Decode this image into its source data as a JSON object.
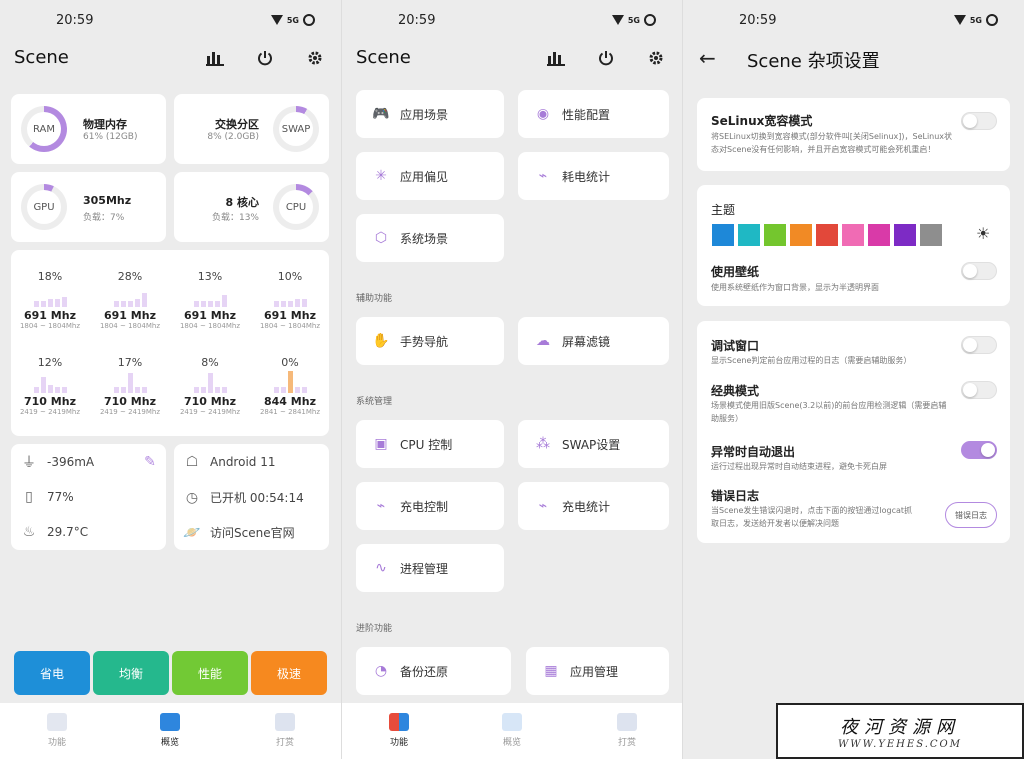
{
  "status": {
    "time": "20:59",
    "net": "5G"
  },
  "panel1": {
    "title": "Scene",
    "ram": {
      "label": "RAM",
      "title": "物理内存",
      "sub": "61% (12GB)",
      "level": 0.61
    },
    "swap": {
      "label": "SWAP",
      "title": "交换分区",
      "sub": "8% (2.0GB)",
      "level": 0.08
    },
    "gpu": {
      "label": "GPU",
      "title": "305Mhz",
      "sub": "负载：7%",
      "level": 0.07
    },
    "cpu": {
      "label": "CPU",
      "title": "8 核心",
      "sub": "负载：13%",
      "level": 0.13
    },
    "cores": [
      {
        "pct": "18%",
        "freq": "691 Mhz",
        "range": "1804 ~ 1804Mhz"
      },
      {
        "pct": "28%",
        "freq": "691 Mhz",
        "range": "1804 ~ 1804Mhz"
      },
      {
        "pct": "13%",
        "freq": "691 Mhz",
        "range": "1804 ~ 1804Mhz"
      },
      {
        "pct": "10%",
        "freq": "691 Mhz",
        "range": "1804 ~ 1804Mhz"
      },
      {
        "pct": "12%",
        "freq": "710 Mhz",
        "range": "2419 ~ 2419Mhz"
      },
      {
        "pct": "17%",
        "freq": "710 Mhz",
        "range": "2419 ~ 2419Mhz"
      },
      {
        "pct": "8%",
        "freq": "710 Mhz",
        "range": "2419 ~ 2419Mhz"
      },
      {
        "pct": "0%",
        "freq": "844 Mhz",
        "range": "2841 ~ 2841Mhz"
      }
    ],
    "battery": {
      "current": "-396mA",
      "level": "77%",
      "temp": "29.7°C"
    },
    "device": {
      "android": "Android 11",
      "uptime": "已开机  00:54:14",
      "site": "访问Scene官网"
    },
    "modes": [
      {
        "label": "省电",
        "color": "#1e8fd8"
      },
      {
        "label": "均衡",
        "color": "#25b88d"
      },
      {
        "label": "性能",
        "color": "#72c935"
      },
      {
        "label": "极速",
        "color": "#f6891f"
      }
    ],
    "nav": [
      "功能",
      "概览",
      "打赏"
    ]
  },
  "panel2": {
    "title": "Scene",
    "items": {
      "app_scene": "应用场景",
      "perf_config": "性能配置",
      "app_pref": "应用偏见",
      "power_stats": "耗电统计",
      "sys_scene": "系统场景",
      "gesture": "手势导航",
      "screen_filter": "屏幕滤镜",
      "cpu_ctrl": "CPU 控制",
      "swap_set": "SWAP设置",
      "charge_ctrl": "充电控制",
      "charge_stats": "充电统计",
      "process": "进程管理",
      "backup": "备份还原",
      "app_mgr": "应用管理"
    },
    "sections": {
      "assist": "辅助功能",
      "system": "系统管理",
      "advanced": "进阶功能"
    },
    "nav": [
      "功能",
      "概览",
      "打赏"
    ]
  },
  "panel3": {
    "title": "Scene 杂项设置",
    "selinux": {
      "title": "SeLinux宽容模式",
      "desc1": "将SELinux切换到宽容模式(部分软件叫[关闭Selinux])，SeLinux状",
      "desc2": "态对Scene没有任何影响，并且开启宽容模式可能会死机重启！"
    },
    "theme": {
      "title": "主题",
      "colors": [
        "#1e88d8",
        "#1fb8c4",
        "#74c62e",
        "#f18a25",
        "#e2483a",
        "#f06bb4",
        "#d93aa8",
        "#7d2bc5",
        "#8e8e8e"
      ]
    },
    "wallpaper": {
      "title": "使用壁纸",
      "desc": "使用系统壁纸作为窗口背景，显示为半透明界面"
    },
    "debug": {
      "title": "调试窗口",
      "desc": "显示Scene判定前台应用过程的日志（需要启辅助服务）"
    },
    "classic": {
      "title": "经典模式",
      "desc1": "场景模式使用旧版Scene(3.2以前)的前台应用检测逻辑（需要启辅",
      "desc2": "助服务）"
    },
    "autoexit": {
      "title": "异常时自动退出",
      "desc": "运行过程出现异常时自动结束进程，避免卡死白屏"
    },
    "errlog": {
      "title": "错误日志",
      "desc1": "当Scene发生错误闪退时，点击下面的按钮通过logcat抓",
      "desc2": "取日志，发送给开发者以便解决问题",
      "button": "错误日志"
    }
  },
  "watermark": {
    "line1": "夜河资源网",
    "line2": "WWW.YEHES.COM"
  }
}
